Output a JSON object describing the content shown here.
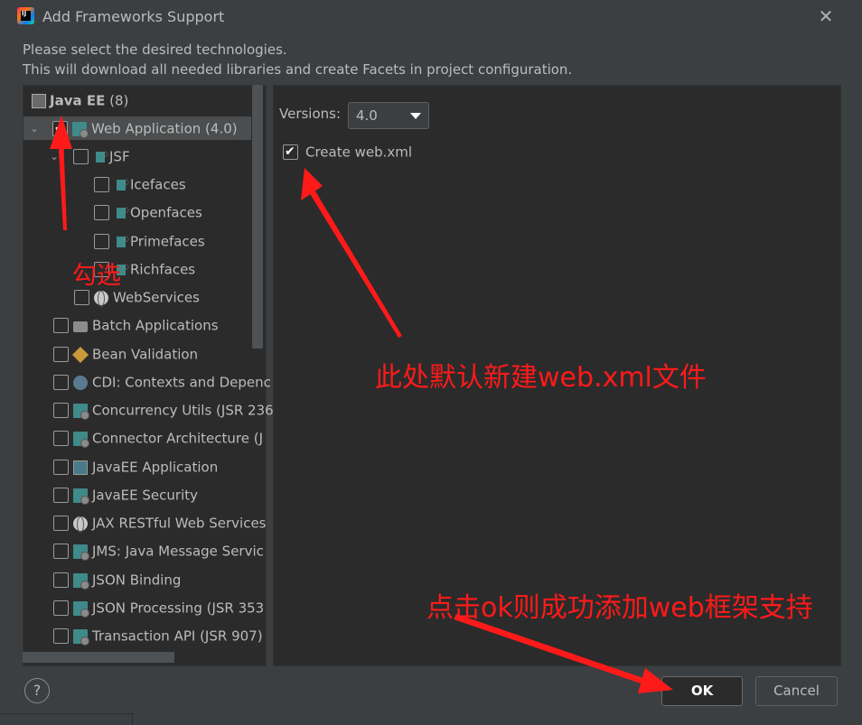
{
  "window": {
    "title": "Add Frameworks Support",
    "close_label": "✕"
  },
  "description": {
    "line1": "Please select the desired technologies.",
    "line2": "This will download all needed libraries and create Facets in project configuration."
  },
  "tree": {
    "root_label": "Java EE",
    "root_count": "(8)",
    "items": [
      {
        "label": "Web Application (4.0)",
        "checked": true
      },
      {
        "label": "JSF",
        "checked": false
      },
      {
        "label": "Icefaces",
        "checked": false
      },
      {
        "label": "Openfaces",
        "checked": false
      },
      {
        "label": "Primefaces",
        "checked": false
      },
      {
        "label": "Richfaces",
        "checked": false
      },
      {
        "label": "WebServices",
        "checked": false
      },
      {
        "label": "Batch Applications",
        "checked": false
      },
      {
        "label": "Bean Validation",
        "checked": false
      },
      {
        "label": "CDI: Contexts and Depenc",
        "checked": false
      },
      {
        "label": "Concurrency Utils (JSR 236",
        "checked": false
      },
      {
        "label": "Connector Architecture (J",
        "checked": false
      },
      {
        "label": "JavaEE Application",
        "checked": false
      },
      {
        "label": "JavaEE Security",
        "checked": false
      },
      {
        "label": "JAX RESTful Web Services",
        "checked": false
      },
      {
        "label": "JMS: Java Message Servic",
        "checked": false
      },
      {
        "label": "JSON Binding",
        "checked": false
      },
      {
        "label": "JSON Processing (JSR 353",
        "checked": false
      },
      {
        "label": "Transaction API (JSR 907)",
        "checked": false
      }
    ]
  },
  "settings": {
    "versions_label": "Versions:",
    "versions_value": "4.0",
    "create_webxml_label": "Create web.xml",
    "create_webxml_checked": true
  },
  "buttons": {
    "help": "?",
    "ok": "OK",
    "cancel": "Cancel"
  },
  "annotations": {
    "check": "勾选",
    "default_webxml": "此处默认新建web.xml文件",
    "click_ok": "点击ok则成功添加web框架支持",
    "color": "#ff1a1a"
  }
}
